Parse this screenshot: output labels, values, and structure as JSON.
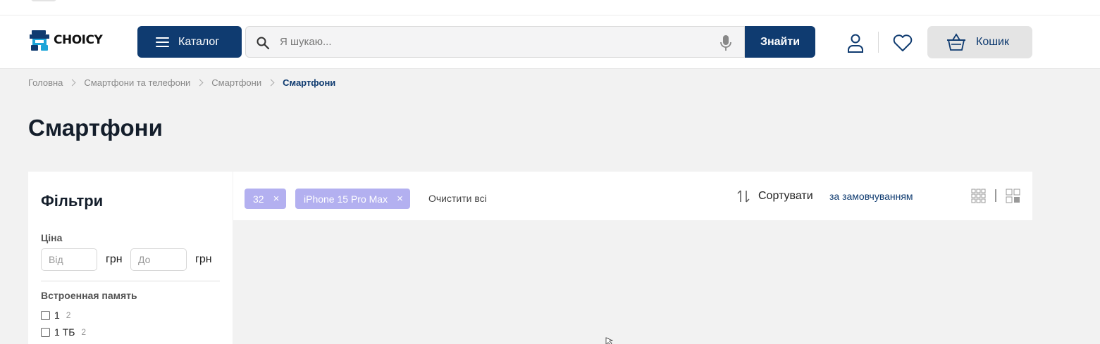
{
  "header": {
    "logo_text": "CHOICY",
    "catalog_label": "Каталог",
    "search_placeholder": "Я шукаю...",
    "find_label": "Знайти",
    "cart_label": "Кошик"
  },
  "breadcrumb": [
    "Головна",
    "Смартфони та телефони",
    "Смартфони",
    "Смартфони"
  ],
  "page_title": "Смартфони",
  "filters": {
    "title": "Фільтри",
    "price_label": "Ціна",
    "price_from_placeholder": "Від",
    "price_to_placeholder": "До",
    "currency": "грн",
    "memory_label": "Встроенная память",
    "memory_options": [
      {
        "label": "1",
        "count": "2"
      },
      {
        "label": "1 ТБ",
        "count": "2"
      }
    ]
  },
  "toolbar": {
    "chips": [
      "32",
      "iPhone 15 Pro Max"
    ],
    "chip_close": "×",
    "clear_all": "Очистити всі",
    "sort_label": "Сортувати",
    "sort_value": "за замовчуванням"
  },
  "colors": {
    "brand": "#0f3b70",
    "chip": "#b3b0f0",
    "logo_accent": "#1ea5d8"
  }
}
